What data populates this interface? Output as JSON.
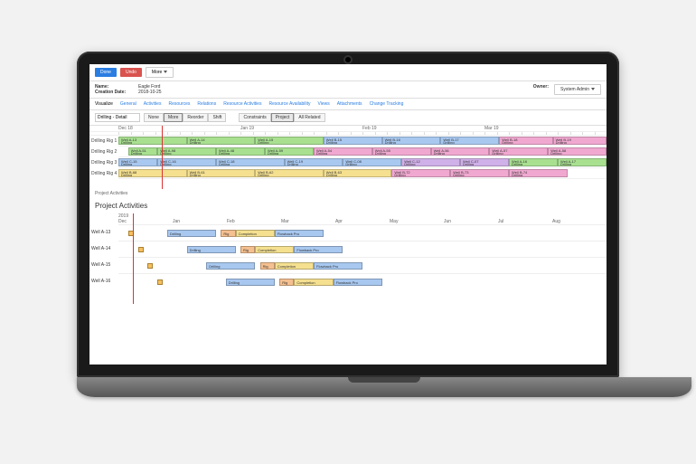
{
  "toolbar": {
    "done": "Done",
    "undo": "Undo",
    "more": "More"
  },
  "info": {
    "name_lbl": "Name:",
    "name": "Eagle Ford",
    "date_lbl": "Creation Date:",
    "date": "2018-10-25",
    "owner_lbl": "Owner:",
    "admin": "System Admin"
  },
  "tabs": [
    "Visualize",
    "General",
    "Activities",
    "Resources",
    "Relations",
    "Resource Activities",
    "Resource Availability",
    "Views",
    "Attachments",
    "Change Tracking"
  ],
  "vbar": {
    "view": "Drilling - Detail",
    "btns": [
      "None",
      "More",
      "Reorder",
      "Shift"
    ],
    "right": [
      "Constraints",
      "Project",
      "All Related"
    ]
  },
  "months": [
    "Dec 18",
    "Jan 19",
    "Feb 19",
    "Mar 19"
  ],
  "rigs": [
    {
      "name": "Drilling Rig 1",
      "bars": [
        {
          "l": 0,
          "w": 14,
          "c": "bg-g",
          "t": "Well A-13\\nDrilling"
        },
        {
          "l": 14,
          "w": 14,
          "c": "bg-g",
          "t": "Well A-14\\nDrilling"
        },
        {
          "l": 28,
          "w": 14,
          "c": "bg-g",
          "t": "Well A-15\\nDrilling"
        },
        {
          "l": 42,
          "w": 12,
          "c": "bg-b",
          "t": "Well B-15\\nDrilling"
        },
        {
          "l": 54,
          "w": 12,
          "c": "bg-b",
          "t": "Well B-16\\nDrilling"
        },
        {
          "l": 66,
          "w": 12,
          "c": "bg-b",
          "t": "Well B-17\\nDrilling"
        },
        {
          "l": 78,
          "w": 11,
          "c": "bg-p",
          "t": "Well B-18\\nDrilling"
        },
        {
          "l": 89,
          "w": 11,
          "c": "bg-p",
          "t": "Well B-19\\nDrilling"
        }
      ]
    },
    {
      "name": "Drilling Rig 2",
      "bars": [
        {
          "l": 2,
          "w": 6,
          "c": "bg-g",
          "t": "Well A-51\\nDrilling"
        },
        {
          "l": 8,
          "w": 12,
          "c": "bg-g",
          "t": "Well A-98\\nDrilling"
        },
        {
          "l": 20,
          "w": 10,
          "c": "bg-g",
          "t": "Well A-48\\nDrilling"
        },
        {
          "l": 30,
          "w": 10,
          "c": "bg-g",
          "t": "Well A-59\\nDrilling"
        },
        {
          "l": 40,
          "w": 12,
          "c": "bg-p",
          "t": "Well A-54\\nDrilling"
        },
        {
          "l": 52,
          "w": 12,
          "c": "bg-p",
          "t": "Well A-55\\nDrilling"
        },
        {
          "l": 64,
          "w": 12,
          "c": "bg-p",
          "t": "Well A-56\\nDrilling"
        },
        {
          "l": 76,
          "w": 12,
          "c": "bg-p",
          "t": "Well A-57\\nDrilling"
        },
        {
          "l": 88,
          "w": 12,
          "c": "bg-p",
          "t": "Well A-58\\nDrilling"
        }
      ]
    },
    {
      "name": "Drilling Rig 3",
      "bars": [
        {
          "l": 0,
          "w": 8,
          "c": "bg-b",
          "t": "Well C-15\\nDrilling"
        },
        {
          "l": 8,
          "w": 12,
          "c": "bg-b",
          "t": "Well C-16\\nDrilling"
        },
        {
          "l": 20,
          "w": 14,
          "c": "bg-b",
          "t": "Well C-18\\nDrilling"
        },
        {
          "l": 34,
          "w": 12,
          "c": "bg-b",
          "t": "Well C-19\\nDrilling"
        },
        {
          "l": 46,
          "w": 12,
          "c": "bg-b",
          "t": "Well C-08\\nDrilling"
        },
        {
          "l": 58,
          "w": 12,
          "c": "bg-v",
          "t": "Well C-12\\nDrilling"
        },
        {
          "l": 70,
          "w": 10,
          "c": "bg-v",
          "t": "Well C-07\\nDrilling"
        },
        {
          "l": 80,
          "w": 10,
          "c": "bg-g",
          "t": "Well A-16\\nDrilling"
        },
        {
          "l": 90,
          "w": 10,
          "c": "bg-g",
          "t": "Well A-17\\nDrilling"
        }
      ]
    },
    {
      "name": "Drilling Rig 4",
      "bars": [
        {
          "l": 0,
          "w": 14,
          "c": "bg-y",
          "t": "Well B-68\\nDrilling"
        },
        {
          "l": 14,
          "w": 14,
          "c": "bg-y",
          "t": "Well B-61\\nDrilling"
        },
        {
          "l": 28,
          "w": 14,
          "c": "bg-y",
          "t": "Well B-62\\nDrilling"
        },
        {
          "l": 42,
          "w": 14,
          "c": "bg-y",
          "t": "Well B-63\\nDrilling"
        },
        {
          "l": 56,
          "w": 12,
          "c": "bg-p",
          "t": "Well B-72\\nDrilling"
        },
        {
          "l": 68,
          "w": 12,
          "c": "bg-p",
          "t": "Well B-73\\nDrilling"
        },
        {
          "l": 80,
          "w": 12,
          "c": "bg-p",
          "t": "Well B-74\\nDrilling"
        }
      ]
    }
  ],
  "pa": {
    "label": "Project Activities",
    "title": "Project Activities",
    "year": "2019",
    "months": [
      "Dec",
      "Jan",
      "Feb",
      "Mar",
      "Apr",
      "May",
      "Jun",
      "Jul",
      "Aug"
    ],
    "rows": [
      {
        "name": "Well A-13",
        "tasks": [
          {
            "l": 10,
            "w": 10,
            "c": "bg-b",
            "t": "Drilling"
          },
          {
            "l": 21,
            "w": 3,
            "c": "bg-o",
            "t": "Rig"
          },
          {
            "l": 24,
            "w": 8,
            "c": "bg-y",
            "t": "Completion"
          },
          {
            "l": 32,
            "w": 10,
            "c": "bg-b",
            "t": "Flowback Pro"
          }
        ]
      },
      {
        "name": "Well A-14",
        "tasks": [
          {
            "l": 14,
            "w": 10,
            "c": "bg-b",
            "t": "Drilling"
          },
          {
            "l": 25,
            "w": 3,
            "c": "bg-o",
            "t": "Rig"
          },
          {
            "l": 28,
            "w": 8,
            "c": "bg-y",
            "t": "Completion"
          },
          {
            "l": 36,
            "w": 10,
            "c": "bg-b",
            "t": "Flowback Pro"
          }
        ]
      },
      {
        "name": "Well A-15",
        "tasks": [
          {
            "l": 18,
            "w": 10,
            "c": "bg-b",
            "t": "Drilling"
          },
          {
            "l": 29,
            "w": 3,
            "c": "bg-o",
            "t": "Rig"
          },
          {
            "l": 32,
            "w": 8,
            "c": "bg-y",
            "t": "Completion"
          },
          {
            "l": 40,
            "w": 10,
            "c": "bg-b",
            "t": "Flowback Pro"
          }
        ]
      },
      {
        "name": "Well A-16",
        "tasks": [
          {
            "l": 22,
            "w": 10,
            "c": "bg-b",
            "t": "Drilling"
          },
          {
            "l": 33,
            "w": 3,
            "c": "bg-o",
            "t": "Rig"
          },
          {
            "l": 36,
            "w": 8,
            "c": "bg-y",
            "t": "Completion"
          },
          {
            "l": 44,
            "w": 10,
            "c": "bg-b",
            "t": "Flowback Pro"
          }
        ]
      }
    ]
  }
}
